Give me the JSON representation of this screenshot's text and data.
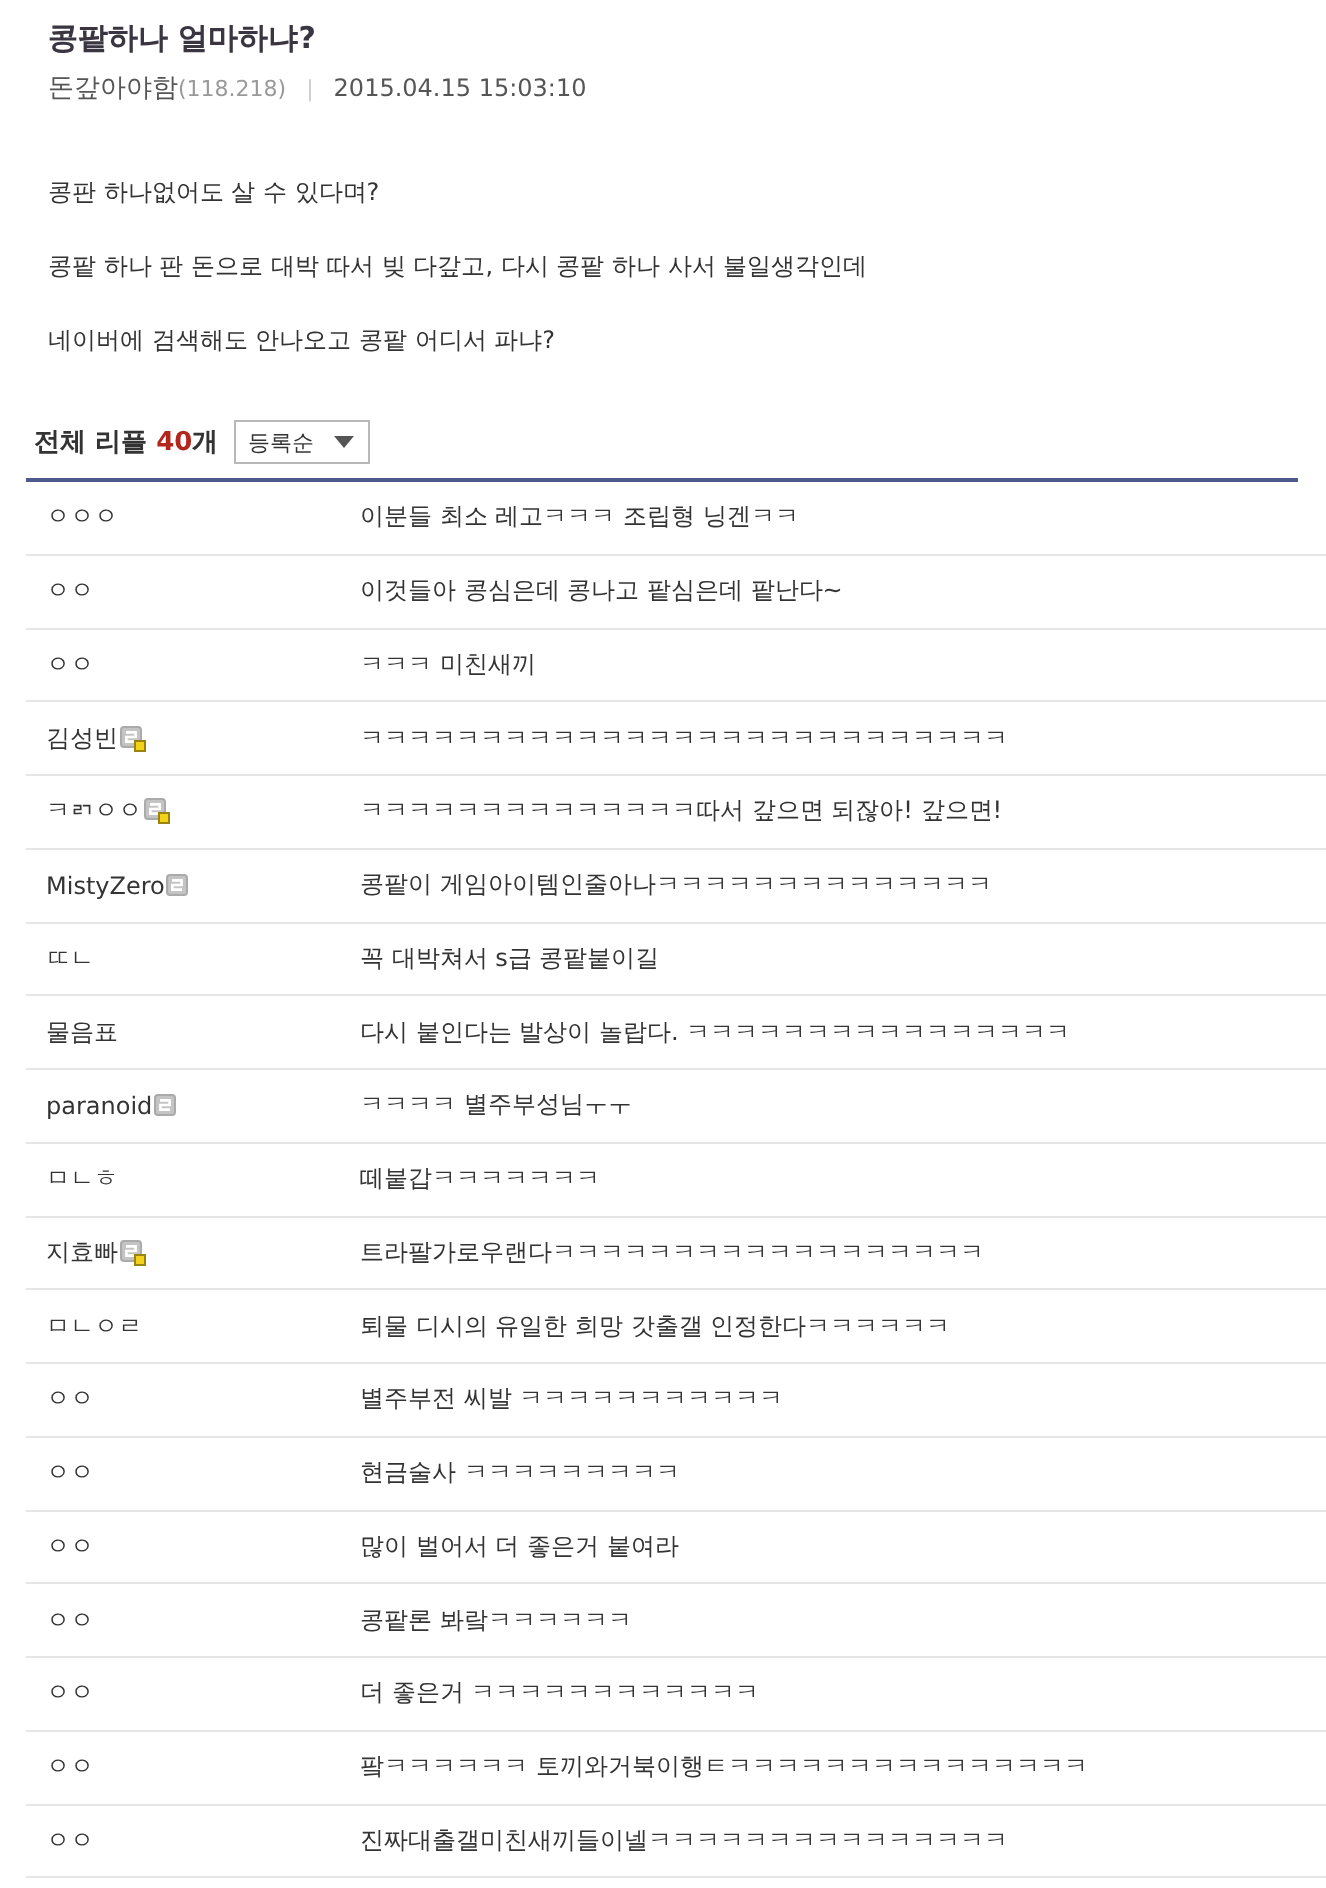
{
  "post": {
    "title": "콩팥하나 얼마하냐?",
    "author": "돈갚아야함",
    "ip": "(118.218)",
    "separator": "|",
    "date": "2015.04.15 15:03:10"
  },
  "body": [
    "콩판 하나없어도 살 수 있다며?",
    "콩팥 하나 판 돈으로 대박 따서 빚 다갚고, 다시 콩팥 하나 사서 불일생각인데",
    "네이버에 검색해도 안나오고 콩팥 어디서 파냐?"
  ],
  "comments_header": {
    "label": "전체 리플",
    "count": "40",
    "count_unit": "개",
    "sort": "등록순"
  },
  "comments": [
    {
      "author": "ㅇㅇㅇ",
      "text": "이분들 최소 레고ㅋㅋㅋ 조립형 닝겐ㅋㅋ"
    },
    {
      "author": "ㅇㅇ",
      "text": "이것들아 콩심은데 콩나고 팥심은데 팥난다~"
    },
    {
      "author": "ㅇㅇ",
      "text": "ㅋㅋㅋ 미친새끼"
    },
    {
      "author": "김성빈",
      "badge": {
        "dot": true
      },
      "text": "ㅋㅋㅋㅋㅋㅋㅋㅋㅋㅋㅋㅋㅋㅋㅋㅋㅋㅋㅋㅋㅋㅋㅋㅋㅋㅋㅋ"
    },
    {
      "author": "ㅋㄺㅇㅇ",
      "badge": {
        "dot": true
      },
      "text": "ㅋㅋㅋㅋㅋㅋㅋㅋㅋㅋㅋㅋㅋㅋ따서 갚으면 되잖아! 갚으면!"
    },
    {
      "author": "MistyZero",
      "badge": {
        "dot": false
      },
      "text": "콩팥이 게임아이템인줄아나ㅋㅋㅋㅋㅋㅋㅋㅋㅋㅋㅋㅋㅋㅋ"
    },
    {
      "author": "ㄸㄴ",
      "text": "꼭 대박쳐서 s급 콩팥붙이길"
    },
    {
      "author": "물음표",
      "text": "다시 붙인다는 발상이 놀랍다. ㅋㅋㅋㅋㅋㅋㅋㅋㅋㅋㅋㅋㅋㅋㅋㅋ"
    },
    {
      "author": "paranoid",
      "badge": {
        "dot": false
      },
      "text": "ㅋㅋㅋㅋ 별주부성님ㅜㅜ"
    },
    {
      "author": "ㅁㄴㅎ",
      "text": "떼붙갑ㅋㅋㅋㅋㅋㅋㅋ"
    },
    {
      "author": "지효빠",
      "badge": {
        "dot": true
      },
      "text": "트라팔가로우랜다ㅋㅋㅋㅋㅋㅋㅋㅋㅋㅋㅋㅋㅋㅋㅋㅋㅋㅋ"
    },
    {
      "author": "ㅁㄴㅇㄹ",
      "text": "퇴물 디시의 유일한 희망 갓출갤 인정한다ㅋㅋㅋㅋㅋㅋ"
    },
    {
      "author": "ㅇㅇ",
      "text": "별주부전 씨발 ㅋㅋㅋㅋㅋㅋㅋㅋㅋㅋㅋ"
    },
    {
      "author": "ㅇㅇ",
      "text": "현금술사 ㅋㅋㅋㅋㅋㅋㅋㅋㅋ"
    },
    {
      "author": "ㅇㅇ",
      "text": "많이 벌어서 더 좋은거 붙여라"
    },
    {
      "author": "ㅇㅇ",
      "text": "콩팥론 봐랔ㅋㅋㅋㅋㅋㅋ"
    },
    {
      "author": "ㅇㅇ",
      "text": "더 좋은거 ㅋㅋㅋㅋㅋㅋㅋㅋㅋㅋㅋㅋ"
    },
    {
      "author": "ㅇㅇ",
      "text": "팤ㅋㅋㅋㅋㅋㅋ 토끼와거북이행ㅌㅋㅋㅋㅋㅋㅋㅋㅋㅋㅋㅋㅋㅋㅋㅋ"
    },
    {
      "author": "ㅇㅇ",
      "text": "진짜대출갤미친새끼들이넬ㅋㅋㅋㅋㅋㅋㅋㅋㅋㅋㅋㅋㅋㅋㅋ"
    }
  ]
}
